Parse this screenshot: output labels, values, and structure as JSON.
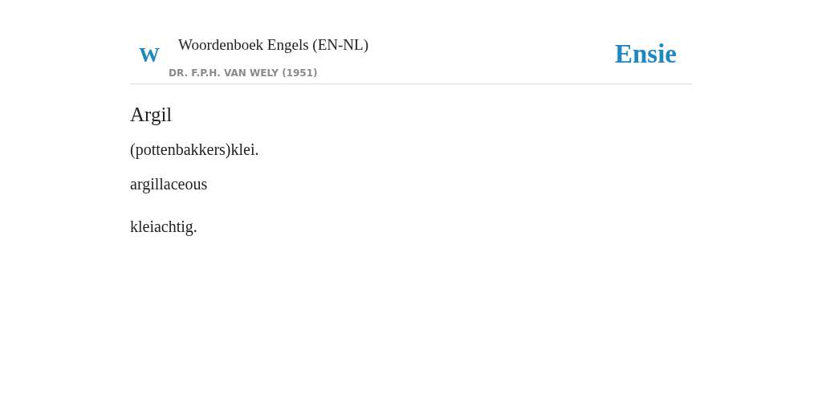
{
  "header": {
    "logo_letter": "W",
    "title": "Woordenboek Engels (EN-NL)",
    "subtitle": "DR. F.P.H. VAN WELY (1951)",
    "brand": "Ensie"
  },
  "entries": [
    {
      "kind": "headword",
      "text": "Argil"
    },
    {
      "kind": "definition",
      "text": "(pottenbakkers)klei."
    },
    {
      "kind": "term",
      "text": "argillaceous"
    },
    {
      "kind": "definition",
      "text": "kleiachtig."
    }
  ]
}
